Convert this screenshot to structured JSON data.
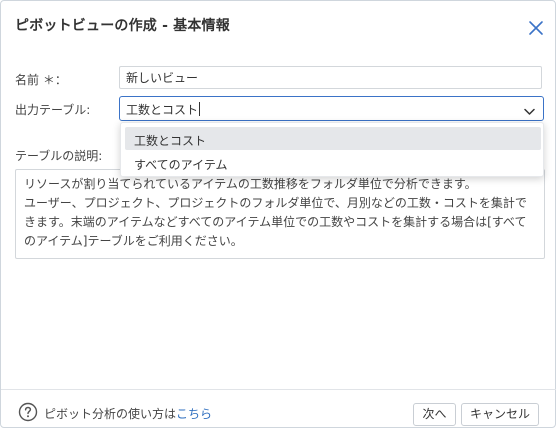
{
  "dialog": {
    "title": "ピボットビューの作成 - 基本情報",
    "close_icon": "close-icon"
  },
  "form": {
    "name_label": "名前 ＊：",
    "name_value": "新しいビュー",
    "table_label": "出力テーブル:",
    "table_value": "工数とコスト",
    "table_options": [
      "工数とコスト",
      "すべてのアイテム"
    ],
    "description_label": "テーブルの説明:",
    "description_text": "リソースが割り当てられているアイテムの工数推移をフォルダ単位で分析できます。\nユーザー、プロジェクト、プロジェクトのフォルダ単位で、月別などの工数・コストを集計できます。末端のアイテムなどすべてのアイテム単位での工数やコストを集計する場合は[すべてのアイテム]テーブルをご利用ください。"
  },
  "footer": {
    "help_prefix": "ピボット分析の使い方は",
    "help_link": "こちら",
    "next_button": "次へ",
    "cancel_button": "キャンセル"
  },
  "colors": {
    "accent": "#3b73c7",
    "link": "#2f6fbf",
    "selected_option_bg": "#e5e7ea"
  }
}
